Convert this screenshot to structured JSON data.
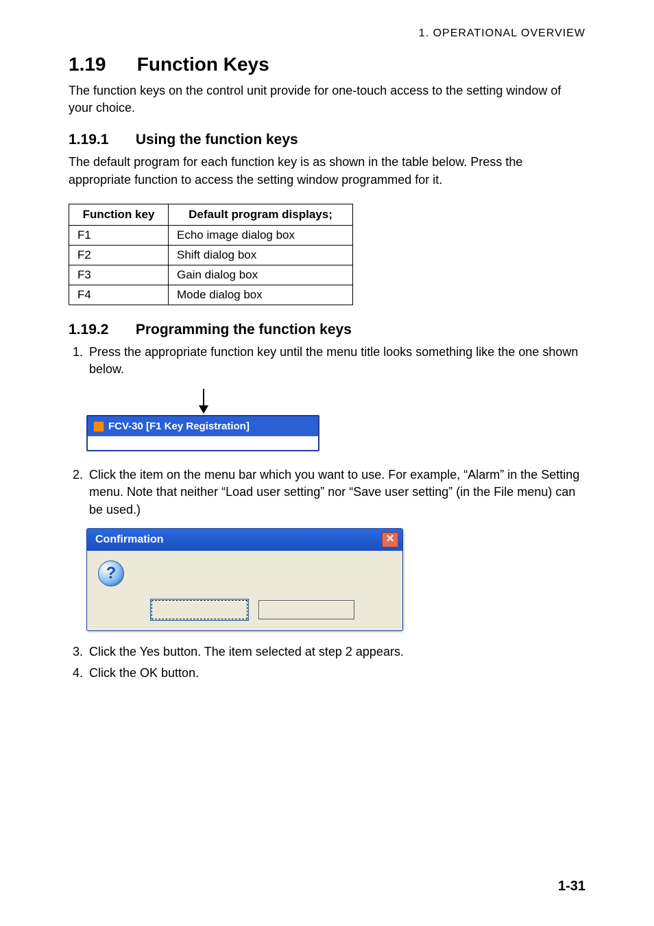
{
  "header": {
    "running_head": "1.  OPERATIONAL  OVERVIEW"
  },
  "section": {
    "number": "1.19",
    "title": "Function Keys",
    "intro": "The function keys on the control unit provide for one-touch access to the setting window of your choice."
  },
  "sub1": {
    "number": "1.19.1",
    "title": "Using the function keys",
    "intro": "The default program for each function key is as shown in the table below. Press the appropriate function to access the setting window programmed for it.",
    "table": {
      "head_key": "Function key",
      "head_prog": "Default program displays;",
      "rows": [
        {
          "key": "F1",
          "prog": "Echo image dialog box"
        },
        {
          "key": "F2",
          "prog": "Shift dialog box"
        },
        {
          "key": "F3",
          "prog": "Gain dialog box"
        },
        {
          "key": "F4",
          "prog": "Mode dialog box"
        }
      ]
    }
  },
  "sub2": {
    "number": "1.19.2",
    "title": "Programming the function keys",
    "steps": {
      "s1": "Press the appropriate function key until the menu title looks something like the one shown below.",
      "s2": "Click the item on the menu bar which you want to use. For example, “Alarm” in the Setting menu. Note that neither “Load user setting” nor “Save user setting” (in the File menu) can be used.)",
      "s3": "Click the Yes button. The item selected at step 2 appears.",
      "s4": "Click the OK button."
    },
    "titlebar_caption": "FCV-30 [F1 Key Registration]",
    "dialog": {
      "title": "Confirmation",
      "q_glyph": "?",
      "close_glyph": "✕"
    }
  },
  "page_number": "1-31"
}
